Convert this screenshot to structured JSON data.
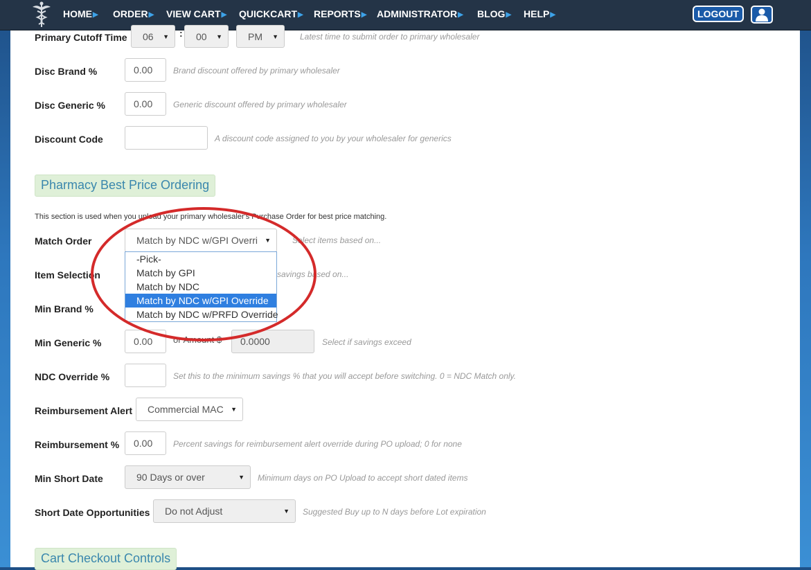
{
  "nav": {
    "items": [
      "HOME",
      "ORDER",
      "VIEW CART",
      "QUICKCART",
      "REPORTS",
      "ADMINISTRATOR",
      "BLOG",
      "HELP"
    ],
    "logout": "LOGOUT"
  },
  "form": {
    "cutoff": {
      "label": "Primary Cutoff Time",
      "hour": "06",
      "sep": ":",
      "minute": "00",
      "ampm": "PM",
      "hint": "Latest time to submit order to primary wholesaler"
    },
    "disc_brand": {
      "label": "Disc Brand %",
      "value": "0.00",
      "hint": "Brand discount offered by primary wholesaler"
    },
    "disc_generic": {
      "label": "Disc Generic %",
      "value": "0.00",
      "hint": "Generic discount offered by primary wholesaler"
    },
    "discount_code": {
      "label": "Discount Code",
      "value": "",
      "hint": "A discount code assigned to you by your wholesaler for generics"
    }
  },
  "best_price": {
    "heading": "Pharmacy Best Price Ordering",
    "description": "This section is used when you upload your primary wholesaler's Purchase Order for best price matching.",
    "match_order": {
      "label": "Match Order",
      "selected": "Match by NDC w/GPI Overri",
      "hint": "Select items based on...",
      "options": [
        "-Pick-",
        "Match by GPI",
        "Match by NDC",
        "Match by NDC w/GPI Override",
        "Match by NDC w/PRFD Override"
      ],
      "selected_index": 3
    },
    "item_selection": {
      "label": "Item Selection",
      "hint": "savings based on..."
    },
    "min_brand": {
      "label": "Min Brand %"
    },
    "min_generic": {
      "label": "Min Generic %",
      "value": "0.00",
      "amount_label": "or Amount $",
      "amount_value": "0.0000",
      "hint": "Select if savings exceed"
    },
    "ndc_override": {
      "label": "NDC Override %",
      "value": "",
      "hint": "Set this to the minimum savings % that you will accept before switching. 0 = NDC Match only."
    },
    "reimb_alert": {
      "label": "Reimbursement Alert",
      "selected": "Commercial MAC"
    },
    "reimb_pct": {
      "label": "Reimbursement %",
      "value": "0.00",
      "hint": "Percent savings for reimbursement alert override during PO upload; 0 for none"
    },
    "min_short_date": {
      "label": "Min Short Date",
      "selected": "90 Days or over",
      "hint": "Minimum days on PO Upload to accept short dated items"
    },
    "short_date_opp": {
      "label": "Short Date Opportunities",
      "selected": "Do not Adjust",
      "hint": "Suggested Buy up to N days before Lot expiration"
    }
  },
  "cart_checkout": {
    "heading": "Cart Checkout Controls"
  },
  "colors": {
    "nav_bg": "#243447",
    "accent": "#3da2e8",
    "section_bg": "#dff0d8",
    "section_text": "#3a87ad",
    "highlight": "#2f7fe0",
    "annotation": "#d42a2a"
  }
}
